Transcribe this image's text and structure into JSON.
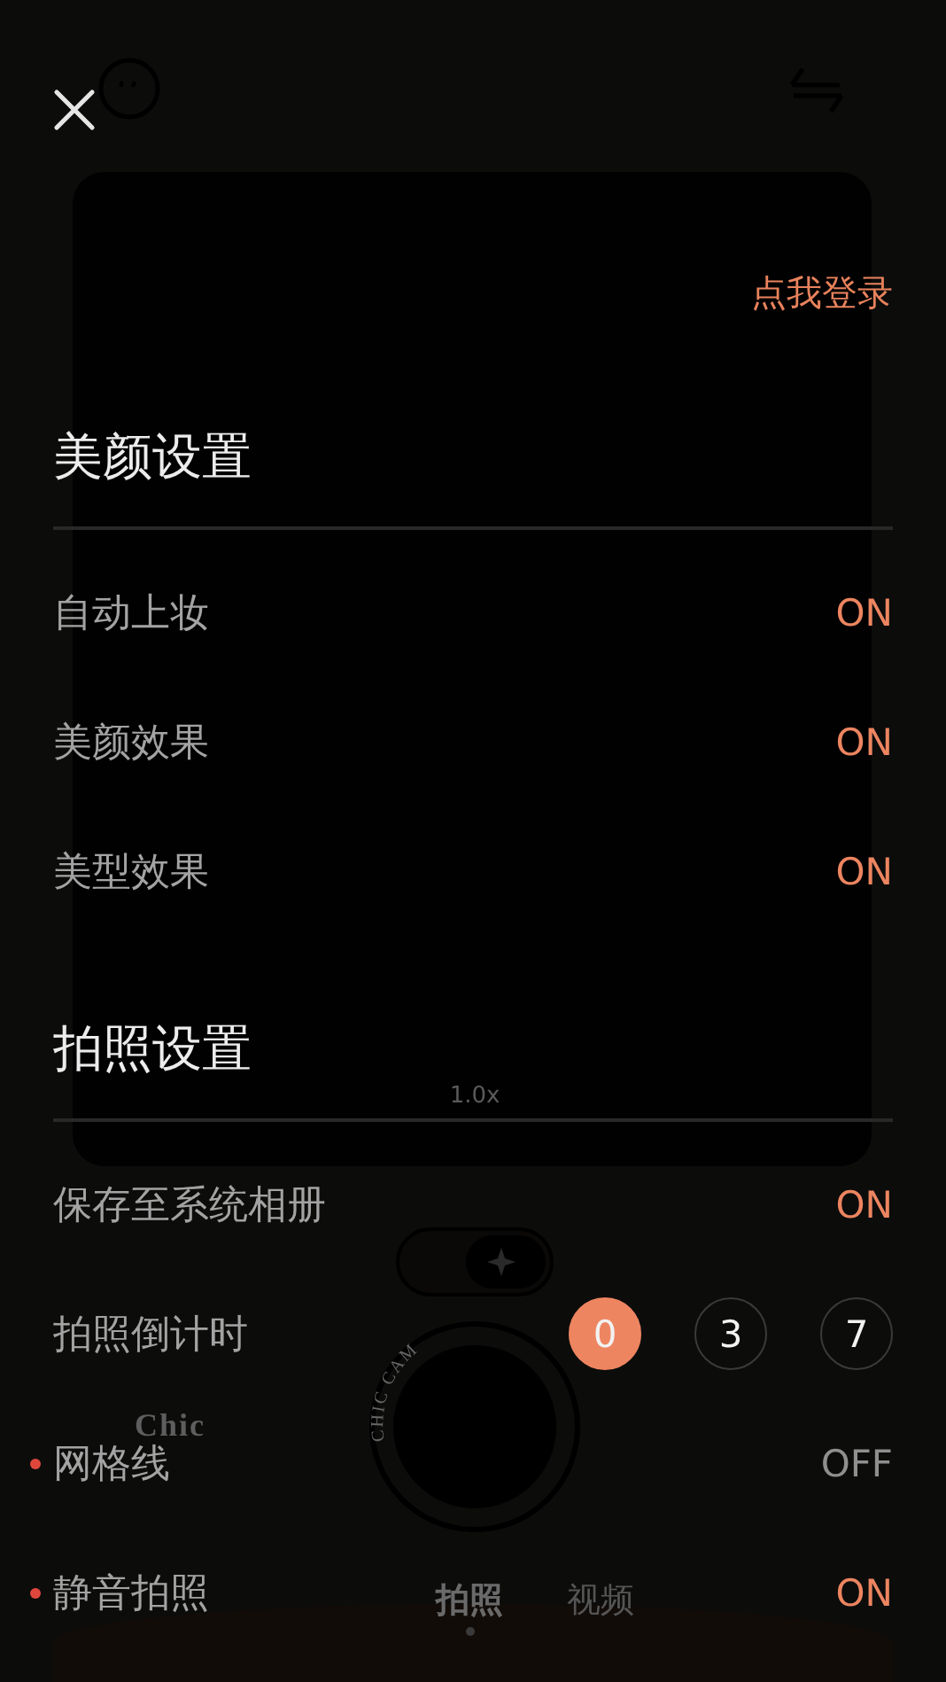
{
  "camera": {
    "zoom": "1.0x",
    "effect_on": true,
    "brand": "Chic",
    "ring_text": "CHIC CAM",
    "modes": [
      {
        "label": "拍照",
        "selected": true
      },
      {
        "label": "视频",
        "selected": false
      }
    ]
  },
  "login_link": "点我登录",
  "sections": [
    {
      "title": "美颜设置",
      "items": [
        {
          "kind": "toggle",
          "label": "自动上妆",
          "value": "ON",
          "on": true,
          "new": false
        },
        {
          "kind": "toggle",
          "label": "美颜效果",
          "value": "ON",
          "on": true,
          "new": false
        },
        {
          "kind": "toggle",
          "label": "美型效果",
          "value": "ON",
          "on": true,
          "new": false
        }
      ]
    },
    {
      "title": "拍照设置",
      "items": [
        {
          "kind": "toggle",
          "label": "保存至系统相册",
          "value": "ON",
          "on": true,
          "new": false
        },
        {
          "kind": "choice",
          "label": "拍照倒计时",
          "new": false,
          "options": [
            {
              "label": "0",
              "selected": true
            },
            {
              "label": "3",
              "selected": false
            },
            {
              "label": "7",
              "selected": false
            }
          ]
        },
        {
          "kind": "toggle",
          "label": "网格线",
          "value": "OFF",
          "on": false,
          "new": true
        },
        {
          "kind": "toggle",
          "label": "静音拍照",
          "value": "ON",
          "on": true,
          "new": true
        }
      ]
    }
  ]
}
